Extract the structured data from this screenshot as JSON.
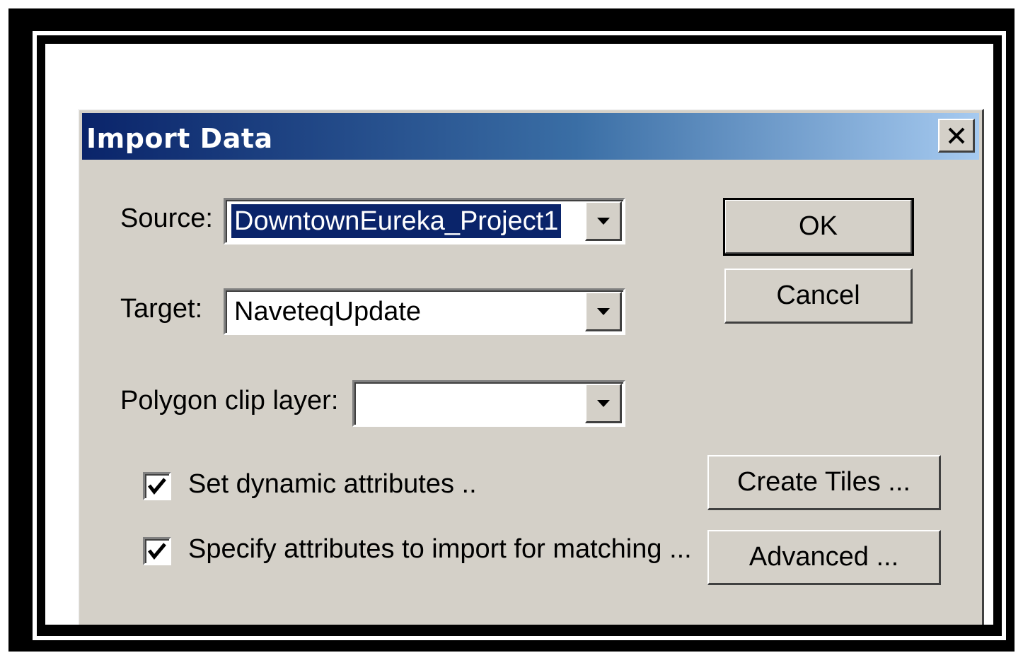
{
  "dialog": {
    "title": "Import Data",
    "close_label": "✕"
  },
  "source": {
    "label": "Source:",
    "value": "DowntownEureka_Project1"
  },
  "target": {
    "label": "Target:",
    "value": "NaveteqUpdate"
  },
  "polygon_clip": {
    "label": "Polygon clip layer:",
    "value": ""
  },
  "checkboxes": [
    {
      "label": "Set dynamic attributes ..",
      "checked": true
    },
    {
      "label": "Specify attributes to import for matching ...",
      "checked": true
    }
  ],
  "buttons": {
    "ok": "OK",
    "cancel": "Cancel",
    "create_tiles": "Create Tiles ...",
    "advanced": "Advanced ..."
  },
  "colors": {
    "title_gradient_start": "#0a246a",
    "title_gradient_end": "#a6caf0",
    "dialog_bg": "#d4d0c8",
    "selection": "#0a246a"
  }
}
